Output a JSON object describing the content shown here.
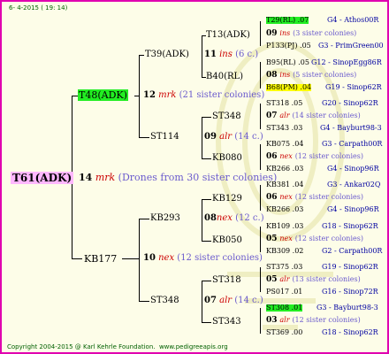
{
  "header": {
    "date": "6- 4-2015 ( 19: 14)"
  },
  "footer": {
    "copyright": "Copyright 2004-2015 @ Karl Kehrle Foundation.",
    "website": "www.pedigreeapis.org"
  },
  "colors": {
    "frame": "#e000b0",
    "background": "#fdfde8",
    "queen_highlight": "#22ee22",
    "mark_highlight": "#ffff00",
    "root_highlight": "#ffb8ff",
    "sister_text": "#6a5acd",
    "italic_red": "#cc0000",
    "link_blue": "#0000a0"
  },
  "gen1": {
    "queen": "T61(ADK)",
    "num": "14",
    "mark": "mrk",
    "note": "(Drones from 30 sister colonies)"
  },
  "gen2": [
    {
      "queen": "T48(ADK)",
      "num": "12",
      "mark": "mrk",
      "note": "(21 sister colonies)"
    },
    {
      "queen": "KB177",
      "num": "10",
      "mark": "nex",
      "note": "(12 sister colonies)"
    }
  ],
  "gen3": [
    {
      "queen": "T39(ADK)",
      "num": "11",
      "mark": "ins",
      "note": "(6 c.)"
    },
    {
      "queen": "ST114",
      "num": "09",
      "mark": "alr",
      "note": "(14 c.)"
    },
    {
      "queen": "KB293",
      "num": "08",
      "mark": "nex",
      "note": "(12 c.)"
    },
    {
      "queen": "ST348",
      "num": "07",
      "mark": "alr",
      "note": "(14 c.)"
    }
  ],
  "gen4": [
    "T13(ADK)",
    "B40(RL)",
    "ST348",
    "KB080",
    "KB129",
    "KB050",
    "ST318",
    "ST343"
  ],
  "gen5": [
    {
      "top": "T29(RL) .07",
      "top_info": "G4 - Athos00R",
      "num": "09",
      "mark": "ins",
      "note": "(3 sister colonies)",
      "bottom": "P133(PJ) .05",
      "bottom_info": "G3 - PrimGreen00"
    },
    {
      "top": "B95(RL) .05",
      "top_info": "G12 - SinopEgg86R",
      "num": "08",
      "mark": "ins",
      "note": "(5 sister colonies)",
      "bottom": "B68(PM) .04",
      "bottom_info": "G19 - Sinop62R"
    },
    {
      "top": "ST318 .05",
      "top_info": "G20 - Sinop62R",
      "num": "07",
      "mark": "alr",
      "note": "(14 sister colonies)",
      "bottom": "ST343 .03",
      "bottom_info": "G4 - Bayburt98-3"
    },
    {
      "top": "KB075 .04",
      "top_info": "G3 - Carpath00R",
      "num": "06",
      "mark": "nex",
      "note": "(12 sister colonies)",
      "bottom": "KB266 .03",
      "bottom_info": "G4 - Sinop96R"
    },
    {
      "top": "KB381 .04",
      "top_info": "G3 - Ankar02Q",
      "num": "06",
      "mark": "nex",
      "note": "(12 sister colonies)",
      "bottom": "KB266 .03",
      "bottom_info": "G4 - Sinop96R"
    },
    {
      "top": "KB109 .03",
      "top_info": "G18 - Sinop62R",
      "num": "05",
      "mark": "nex",
      "note": "(12 sister colonies)",
      "bottom": "KB309 .02",
      "bottom_info": "G2 - Carpath00R"
    },
    {
      "top": "ST375 .03",
      "top_info": "G19 - Sinop62R",
      "num": "05",
      "mark": "alr",
      "note": "(13 sister colonies)",
      "bottom": "PS017 .01",
      "bottom_info": "G16 - Sinop72R"
    },
    {
      "top": "ST308 .01",
      "top_info": "G3 - Bayburt98-3",
      "num": "03",
      "mark": "alr",
      "note": "(12 sister colonies)",
      "bottom": "ST369 .00",
      "bottom_info": "G18 - Sinop62R"
    }
  ]
}
